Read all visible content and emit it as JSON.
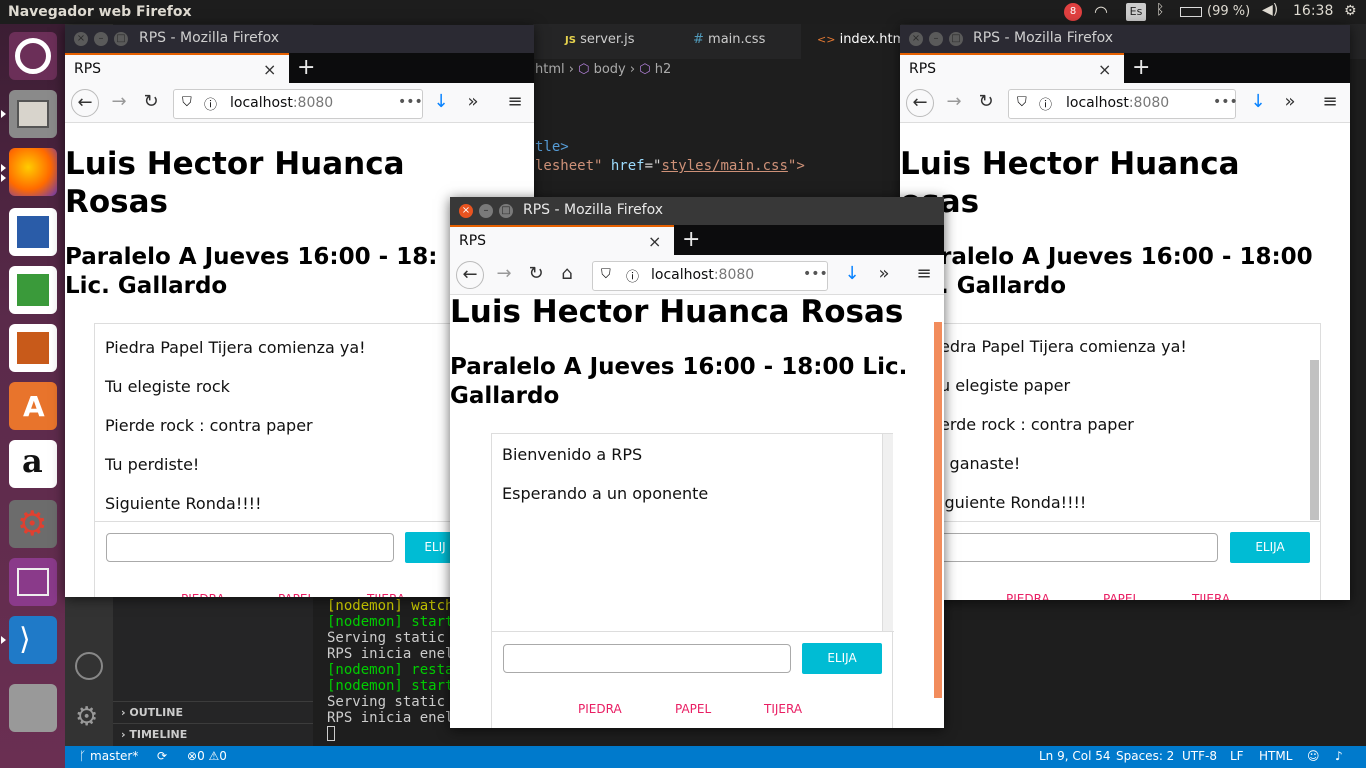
{
  "topbar": {
    "app_title": "Navegador web Firefox",
    "notif_count": "8",
    "keyboard": "Es",
    "battery": "(99 %)",
    "clock": "16:38"
  },
  "vscode": {
    "tabs": [
      {
        "icon": "JS",
        "label": "server.js"
      },
      {
        "icon": "#",
        "label": "main.css"
      },
      {
        "icon": "<>",
        "label": "index.html"
      }
    ],
    "breadcrumb": [
      "html",
      "body",
      "h2"
    ],
    "code_line1": "tle>",
    "code_line2_a": "lesheet\"",
    "code_line2_b": "href",
    "code_line2_c": "=\"",
    "code_line2_d": "styles/main.css",
    "code_line2_e": "\">",
    "terminal": [
      {
        "text": "[nodemon] watch",
        "color": "#cdcd00"
      },
      {
        "text": "[nodemon] start",
        "color": "#00cd00"
      },
      {
        "text": "Serving static",
        "color": "#cccccc"
      },
      {
        "text": "RPS inicia enel",
        "color": "#cccccc"
      },
      {
        "text": "[nodemon] resta",
        "color": "#00cd00"
      },
      {
        "text": "[nodemon] start",
        "color": "#00cd00"
      },
      {
        "text": "Serving static",
        "color": "#cccccc"
      },
      {
        "text": "RPS inicia enel",
        "color": "#cccccc"
      }
    ],
    "outline": "OUTLINE",
    "timeline": "TIMELINE"
  },
  "statusbar": {
    "branch": "master*",
    "errors": "0",
    "warnings": "0",
    "position": "Ln 9, Col 54",
    "spaces": "Spaces: 2",
    "encoding": "UTF-8",
    "eol": "LF",
    "language": "HTML"
  },
  "firefox": {
    "window_title": "RPS - Mozilla Firefox",
    "tab_label": "RPS",
    "url_host": "localhost",
    "url_port": ":8080",
    "page_title": "Luis Hector Huanca Rosas",
    "page_title_line1": "Luis Hector Huanca",
    "page_title_line2": "Rosas",
    "subtitle_full": "Paralelo A Jueves 16:00 - 18:00 Lic. Gallardo",
    "left_sub_line1": "Paralelo A Jueves 16:00 - 18:",
    "left_sub_line2": "Lic. Gallardo",
    "center_sub_line1": "Paralelo A Jueves 16:00 - 18:00 Lic.",
    "center_sub_line2": "Gallardo",
    "right_sub_line1": "ralelo A Jueves 16:00 - 18:00",
    "right_sub_line2": ". Gallardo",
    "right_title_line2": "osas",
    "button_label": "ELIJA",
    "button_label_cut": "ELIJ",
    "choices": [
      "PIEDRA",
      "PAPEL",
      "TIJERA"
    ]
  },
  "left_messages": [
    "Piedra Papel Tijera comienza ya!",
    "Tu elegiste rock",
    "Pierde rock : contra paper",
    "Tu perdiste!",
    "Siguiente Ronda!!!!"
  ],
  "center_messages": [
    "Bienvenido a RPS",
    "Esperando a un oponente"
  ],
  "right_messages": [
    "edra Papel Tijera comienza ya!",
    "u elegiste paper",
    "erde rock : contra paper",
    "i ganaste!",
    "iguiente Ronda!!!!"
  ],
  "colors": {
    "accent": "#00bcd4",
    "choice": "#e91e63",
    "status": "#007acc",
    "tab_accent": "#e66000"
  }
}
